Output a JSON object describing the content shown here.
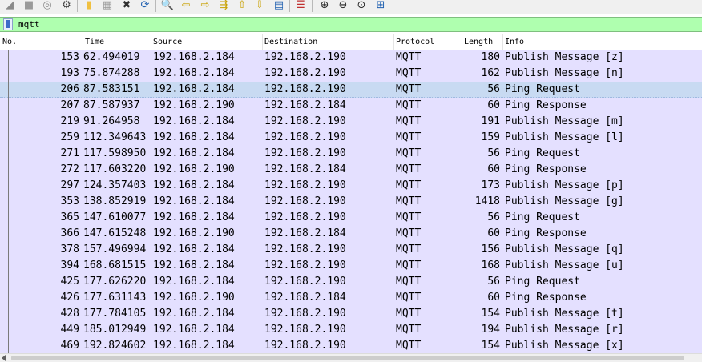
{
  "toolbar": {
    "buttons": [
      {
        "icon": "stop-capture-icon",
        "glyph": "◢",
        "color": "#8a8a8a"
      },
      {
        "icon": "restart-capture-icon",
        "glyph": "■",
        "color": "#9a9a9a"
      },
      {
        "icon": "capture-options-icon",
        "glyph": "◎",
        "color": "#8a8a8a"
      },
      {
        "icon": "gear-icon",
        "glyph": "⚙",
        "color": "#404040"
      },
      {
        "icon": "open-file-icon",
        "glyph": "▮",
        "color": "#f0c040"
      },
      {
        "icon": "save-file-icon",
        "glyph": "▦",
        "color": "#9a9a9a"
      },
      {
        "icon": "close-file-icon",
        "glyph": "✖",
        "color": "#303030"
      },
      {
        "icon": "reload-file-icon",
        "glyph": "⟳",
        "color": "#2060b0"
      },
      {
        "icon": "find-packet-icon",
        "glyph": "🔍",
        "color": "#202020"
      },
      {
        "icon": "go-back-icon",
        "glyph": "⇦",
        "color": "#c8a000"
      },
      {
        "icon": "go-forward-icon",
        "glyph": "⇨",
        "color": "#c8a000"
      },
      {
        "icon": "go-to-packet-icon",
        "glyph": "⇶",
        "color": "#c8a000"
      },
      {
        "icon": "go-first-icon",
        "glyph": "⇧",
        "color": "#c8a000"
      },
      {
        "icon": "go-last-icon",
        "glyph": "⇩",
        "color": "#c8a000"
      },
      {
        "icon": "autoscroll-icon",
        "glyph": "▤",
        "color": "#2060b0"
      },
      {
        "icon": "colorize-icon",
        "glyph": "☰",
        "color": "#c03030"
      },
      {
        "icon": "zoom-in-icon",
        "glyph": "⊕",
        "color": "#202020"
      },
      {
        "icon": "zoom-out-icon",
        "glyph": "⊖",
        "color": "#202020"
      },
      {
        "icon": "zoom-normal-icon",
        "glyph": "⊙",
        "color": "#202020"
      },
      {
        "icon": "resize-columns-icon",
        "glyph": "⊞",
        "color": "#2060b0"
      }
    ]
  },
  "filter": {
    "value": "mqtt",
    "background": "#afffaf"
  },
  "columns": [
    "No.",
    "Time",
    "Source",
    "Destination",
    "Protocol",
    "Length",
    "Info"
  ],
  "colors": {
    "row_bg": "#e4e0ff",
    "selected_bg": "#c8daf2"
  },
  "rows": [
    {
      "no": "153",
      "time": "62.494019",
      "src": "192.168.2.184",
      "dst": "192.168.2.190",
      "proto": "MQTT",
      "len": "180",
      "info": "Publish Message [z]"
    },
    {
      "no": "193",
      "time": "75.874288",
      "src": "192.168.2.184",
      "dst": "192.168.2.190",
      "proto": "MQTT",
      "len": "162",
      "info": "Publish Message [n]"
    },
    {
      "no": "206",
      "time": "87.583151",
      "src": "192.168.2.184",
      "dst": "192.168.2.190",
      "proto": "MQTT",
      "len": "56",
      "info": "Ping Request",
      "selected": true
    },
    {
      "no": "207",
      "time": "87.587937",
      "src": "192.168.2.190",
      "dst": "192.168.2.184",
      "proto": "MQTT",
      "len": "60",
      "info": "Ping Response"
    },
    {
      "no": "219",
      "time": "91.264958",
      "src": "192.168.2.184",
      "dst": "192.168.2.190",
      "proto": "MQTT",
      "len": "191",
      "info": "Publish Message [m]"
    },
    {
      "no": "259",
      "time": "112.349643",
      "src": "192.168.2.184",
      "dst": "192.168.2.190",
      "proto": "MQTT",
      "len": "159",
      "info": "Publish Message [l]"
    },
    {
      "no": "271",
      "time": "117.598950",
      "src": "192.168.2.184",
      "dst": "192.168.2.190",
      "proto": "MQTT",
      "len": "56",
      "info": "Ping Request"
    },
    {
      "no": "272",
      "time": "117.603220",
      "src": "192.168.2.190",
      "dst": "192.168.2.184",
      "proto": "MQTT",
      "len": "60",
      "info": "Ping Response"
    },
    {
      "no": "297",
      "time": "124.357403",
      "src": "192.168.2.184",
      "dst": "192.168.2.190",
      "proto": "MQTT",
      "len": "173",
      "info": "Publish Message [p]"
    },
    {
      "no": "353",
      "time": "138.852919",
      "src": "192.168.2.184",
      "dst": "192.168.2.190",
      "proto": "MQTT",
      "len": "1418",
      "info": "Publish Message [g]"
    },
    {
      "no": "365",
      "time": "147.610077",
      "src": "192.168.2.184",
      "dst": "192.168.2.190",
      "proto": "MQTT",
      "len": "56",
      "info": "Ping Request"
    },
    {
      "no": "366",
      "time": "147.615248",
      "src": "192.168.2.190",
      "dst": "192.168.2.184",
      "proto": "MQTT",
      "len": "60",
      "info": "Ping Response"
    },
    {
      "no": "378",
      "time": "157.496994",
      "src": "192.168.2.184",
      "dst": "192.168.2.190",
      "proto": "MQTT",
      "len": "156",
      "info": "Publish Message [q]"
    },
    {
      "no": "394",
      "time": "168.681515",
      "src": "192.168.2.184",
      "dst": "192.168.2.190",
      "proto": "MQTT",
      "len": "168",
      "info": "Publish Message [u]"
    },
    {
      "no": "425",
      "time": "177.626220",
      "src": "192.168.2.184",
      "dst": "192.168.2.190",
      "proto": "MQTT",
      "len": "56",
      "info": "Ping Request"
    },
    {
      "no": "426",
      "time": "177.631143",
      "src": "192.168.2.190",
      "dst": "192.168.2.184",
      "proto": "MQTT",
      "len": "60",
      "info": "Ping Response"
    },
    {
      "no": "428",
      "time": "177.784105",
      "src": "192.168.2.184",
      "dst": "192.168.2.190",
      "proto": "MQTT",
      "len": "154",
      "info": "Publish Message [t]"
    },
    {
      "no": "449",
      "time": "185.012949",
      "src": "192.168.2.184",
      "dst": "192.168.2.190",
      "proto": "MQTT",
      "len": "194",
      "info": "Publish Message [r]"
    },
    {
      "no": "469",
      "time": "192.824602",
      "src": "192.168.2.184",
      "dst": "192.168.2.190",
      "proto": "MQTT",
      "len": "154",
      "info": "Publish Message [x]"
    }
  ]
}
